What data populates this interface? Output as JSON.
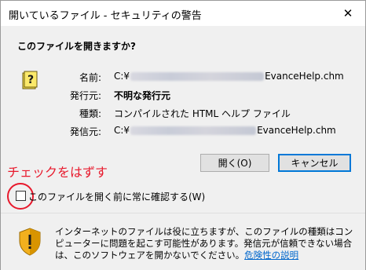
{
  "window": {
    "title": "開いているファイル - セキュリティの警告",
    "close_glyph": "✕"
  },
  "question": "このファイルを開きますか?",
  "details": {
    "name_label": "名前:",
    "name_prefix": "C:¥",
    "name_suffix": "EvanceHelp.chm",
    "publisher_label": "発行元:",
    "publisher_value": "不明な発行元",
    "type_label": "種類:",
    "type_value": "コンパイルされた HTML ヘルプ ファイル",
    "source_label": "発信元:",
    "source_prefix": "C:¥",
    "source_suffix": "EvanceHelp.chm"
  },
  "buttons": {
    "open_label": "開く(O)",
    "cancel_label": "キャンセル"
  },
  "annotation": {
    "text": "チェックをはずす",
    "color": "#e8192c"
  },
  "checkbox": {
    "label": "このファイルを開く前に常に確認する(W)",
    "checked": false
  },
  "footer": {
    "message": "インターネットのファイルは役に立ちますが、このファイルの種類はコンピューターに問題を起こす可能性があります。発信元が信頼できない場合は、このソフトウェアを開かないでください。",
    "link_text": "危険性の説明"
  },
  "icons": {
    "file": "help-file-icon",
    "shield": "warning-shield-icon"
  }
}
